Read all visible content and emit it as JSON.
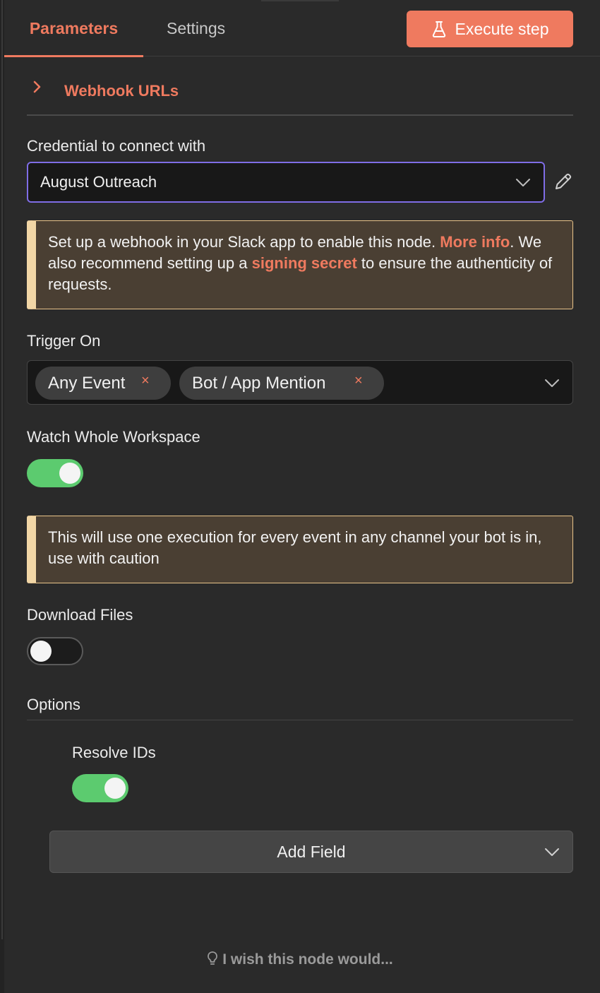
{
  "tabs": {
    "parameters": "Parameters",
    "settings": "Settings"
  },
  "execute_button": {
    "label": "Execute step"
  },
  "webhook_section": {
    "label": "Webhook URLs"
  },
  "credential": {
    "label": "Credential to connect with",
    "value": "August Outreach"
  },
  "notice_webhook": {
    "text_1": "Set up a webhook in your Slack app to enable this node. ",
    "link_1": "More info",
    "text_2": ". We also recommend setting up a ",
    "link_2": "signing secret",
    "text_3": " to ensure the authenticity of requests."
  },
  "trigger_on": {
    "label": "Trigger On",
    "chips": [
      "Any Event",
      "Bot / App Mention"
    ],
    "remove_glyph": "×"
  },
  "watch_workspace": {
    "label": "Watch Whole Workspace",
    "enabled": true
  },
  "notice_caution": {
    "text": "This will use one execution for every event in any channel your bot is in, use with caution"
  },
  "download_files": {
    "label": "Download Files",
    "enabled": false
  },
  "options": {
    "label": "Options",
    "resolve_ids": {
      "label": "Resolve IDs",
      "enabled": true
    },
    "add_field_label": "Add Field"
  },
  "feedback": {
    "label": "I wish this node would..."
  },
  "colors": {
    "accent": "#ef7a5f",
    "toggle_on": "#5ccb6f",
    "focus_border": "#7f6de6",
    "notice_bg": "#4a3f33"
  },
  "icons": {
    "execute": "flask-icon",
    "section_toggle": "chevron-right-icon",
    "dropdown": "chevron-down-icon",
    "edit": "pencil-icon",
    "feedback": "lightbulb-icon"
  }
}
